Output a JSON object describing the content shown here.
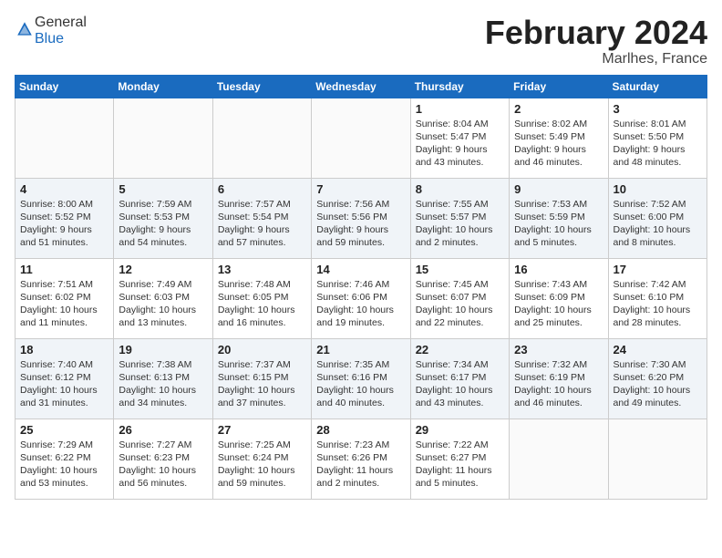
{
  "header": {
    "logo_general": "General",
    "logo_blue": "Blue",
    "month_title": "February 2024",
    "location": "Marlhes, France"
  },
  "days_of_week": [
    "Sunday",
    "Monday",
    "Tuesday",
    "Wednesday",
    "Thursday",
    "Friday",
    "Saturday"
  ],
  "weeks": [
    [
      {
        "day": "",
        "info": ""
      },
      {
        "day": "",
        "info": ""
      },
      {
        "day": "",
        "info": ""
      },
      {
        "day": "",
        "info": ""
      },
      {
        "day": "1",
        "info": "Sunrise: 8:04 AM\nSunset: 5:47 PM\nDaylight: 9 hours\nand 43 minutes."
      },
      {
        "day": "2",
        "info": "Sunrise: 8:02 AM\nSunset: 5:49 PM\nDaylight: 9 hours\nand 46 minutes."
      },
      {
        "day": "3",
        "info": "Sunrise: 8:01 AM\nSunset: 5:50 PM\nDaylight: 9 hours\nand 48 minutes."
      }
    ],
    [
      {
        "day": "4",
        "info": "Sunrise: 8:00 AM\nSunset: 5:52 PM\nDaylight: 9 hours\nand 51 minutes."
      },
      {
        "day": "5",
        "info": "Sunrise: 7:59 AM\nSunset: 5:53 PM\nDaylight: 9 hours\nand 54 minutes."
      },
      {
        "day": "6",
        "info": "Sunrise: 7:57 AM\nSunset: 5:54 PM\nDaylight: 9 hours\nand 57 minutes."
      },
      {
        "day": "7",
        "info": "Sunrise: 7:56 AM\nSunset: 5:56 PM\nDaylight: 9 hours\nand 59 minutes."
      },
      {
        "day": "8",
        "info": "Sunrise: 7:55 AM\nSunset: 5:57 PM\nDaylight: 10 hours\nand 2 minutes."
      },
      {
        "day": "9",
        "info": "Sunrise: 7:53 AM\nSunset: 5:59 PM\nDaylight: 10 hours\nand 5 minutes."
      },
      {
        "day": "10",
        "info": "Sunrise: 7:52 AM\nSunset: 6:00 PM\nDaylight: 10 hours\nand 8 minutes."
      }
    ],
    [
      {
        "day": "11",
        "info": "Sunrise: 7:51 AM\nSunset: 6:02 PM\nDaylight: 10 hours\nand 11 minutes."
      },
      {
        "day": "12",
        "info": "Sunrise: 7:49 AM\nSunset: 6:03 PM\nDaylight: 10 hours\nand 13 minutes."
      },
      {
        "day": "13",
        "info": "Sunrise: 7:48 AM\nSunset: 6:05 PM\nDaylight: 10 hours\nand 16 minutes."
      },
      {
        "day": "14",
        "info": "Sunrise: 7:46 AM\nSunset: 6:06 PM\nDaylight: 10 hours\nand 19 minutes."
      },
      {
        "day": "15",
        "info": "Sunrise: 7:45 AM\nSunset: 6:07 PM\nDaylight: 10 hours\nand 22 minutes."
      },
      {
        "day": "16",
        "info": "Sunrise: 7:43 AM\nSunset: 6:09 PM\nDaylight: 10 hours\nand 25 minutes."
      },
      {
        "day": "17",
        "info": "Sunrise: 7:42 AM\nSunset: 6:10 PM\nDaylight: 10 hours\nand 28 minutes."
      }
    ],
    [
      {
        "day": "18",
        "info": "Sunrise: 7:40 AM\nSunset: 6:12 PM\nDaylight: 10 hours\nand 31 minutes."
      },
      {
        "day": "19",
        "info": "Sunrise: 7:38 AM\nSunset: 6:13 PM\nDaylight: 10 hours\nand 34 minutes."
      },
      {
        "day": "20",
        "info": "Sunrise: 7:37 AM\nSunset: 6:15 PM\nDaylight: 10 hours\nand 37 minutes."
      },
      {
        "day": "21",
        "info": "Sunrise: 7:35 AM\nSunset: 6:16 PM\nDaylight: 10 hours\nand 40 minutes."
      },
      {
        "day": "22",
        "info": "Sunrise: 7:34 AM\nSunset: 6:17 PM\nDaylight: 10 hours\nand 43 minutes."
      },
      {
        "day": "23",
        "info": "Sunrise: 7:32 AM\nSunset: 6:19 PM\nDaylight: 10 hours\nand 46 minutes."
      },
      {
        "day": "24",
        "info": "Sunrise: 7:30 AM\nSunset: 6:20 PM\nDaylight: 10 hours\nand 49 minutes."
      }
    ],
    [
      {
        "day": "25",
        "info": "Sunrise: 7:29 AM\nSunset: 6:22 PM\nDaylight: 10 hours\nand 53 minutes."
      },
      {
        "day": "26",
        "info": "Sunrise: 7:27 AM\nSunset: 6:23 PM\nDaylight: 10 hours\nand 56 minutes."
      },
      {
        "day": "27",
        "info": "Sunrise: 7:25 AM\nSunset: 6:24 PM\nDaylight: 10 hours\nand 59 minutes."
      },
      {
        "day": "28",
        "info": "Sunrise: 7:23 AM\nSunset: 6:26 PM\nDaylight: 11 hours\nand 2 minutes."
      },
      {
        "day": "29",
        "info": "Sunrise: 7:22 AM\nSunset: 6:27 PM\nDaylight: 11 hours\nand 5 minutes."
      },
      {
        "day": "",
        "info": ""
      },
      {
        "day": "",
        "info": ""
      }
    ]
  ]
}
